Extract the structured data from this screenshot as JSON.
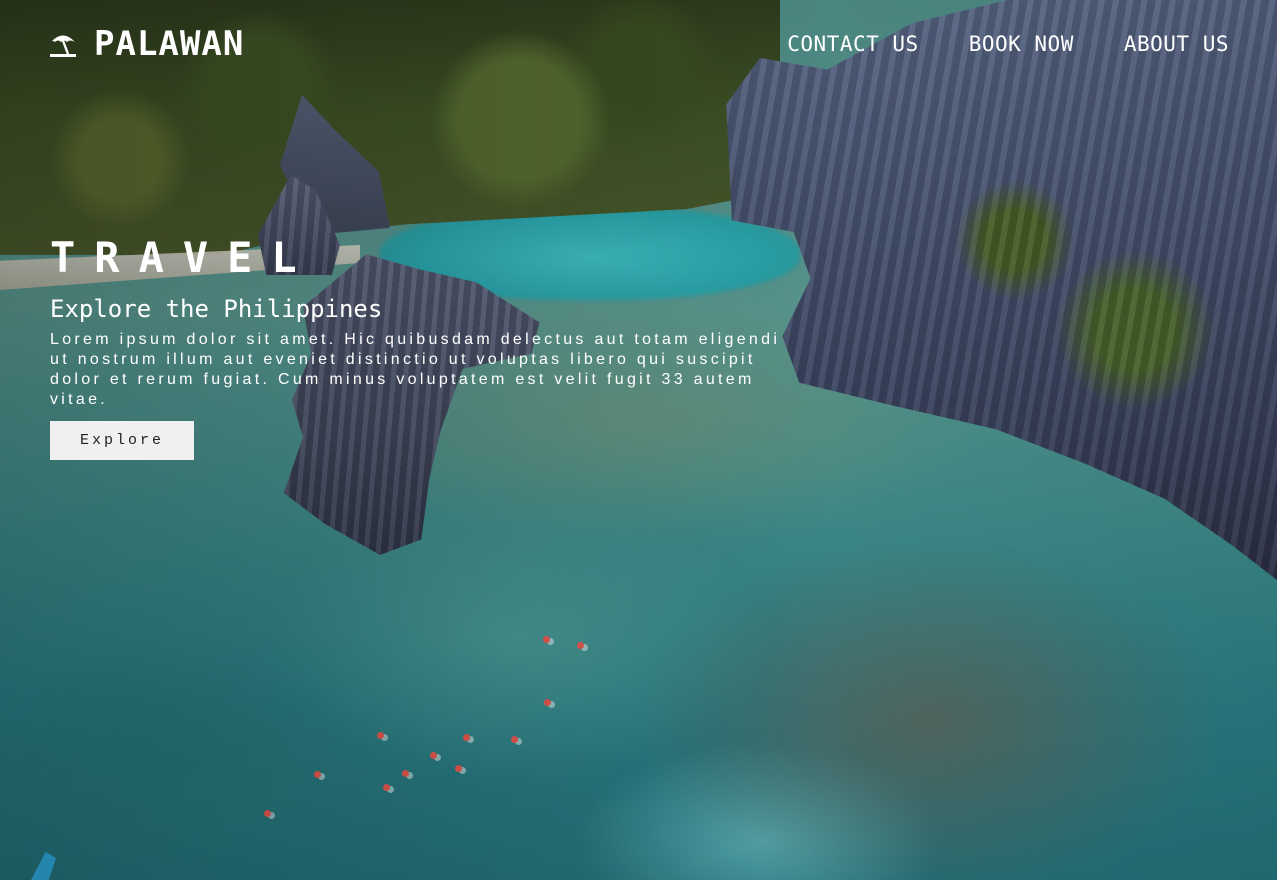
{
  "brand": {
    "name": "PALAWAN",
    "icon": "beach-umbrella-icon"
  },
  "nav": {
    "items": [
      {
        "label": "CONTACT US"
      },
      {
        "label": "BOOK NOW"
      },
      {
        "label": "ABOUT US"
      }
    ]
  },
  "hero": {
    "title": "TRAVEL",
    "subtitle": "Explore the Philippines",
    "body": "Lorem ipsum dolor sit amet. Hic quibusdam delectus aut totam eligendi ut nostrum illum aut eveniet distinctio ut voluptas libero qui suscipit dolor et rerum fugiat. Cum minus voluptatem est velit fugit 33 autem vitae.",
    "cta_label": "Explore"
  },
  "colors": {
    "text": "#ffffff",
    "button_bg": "#f0f0f0",
    "button_text": "#222222"
  }
}
